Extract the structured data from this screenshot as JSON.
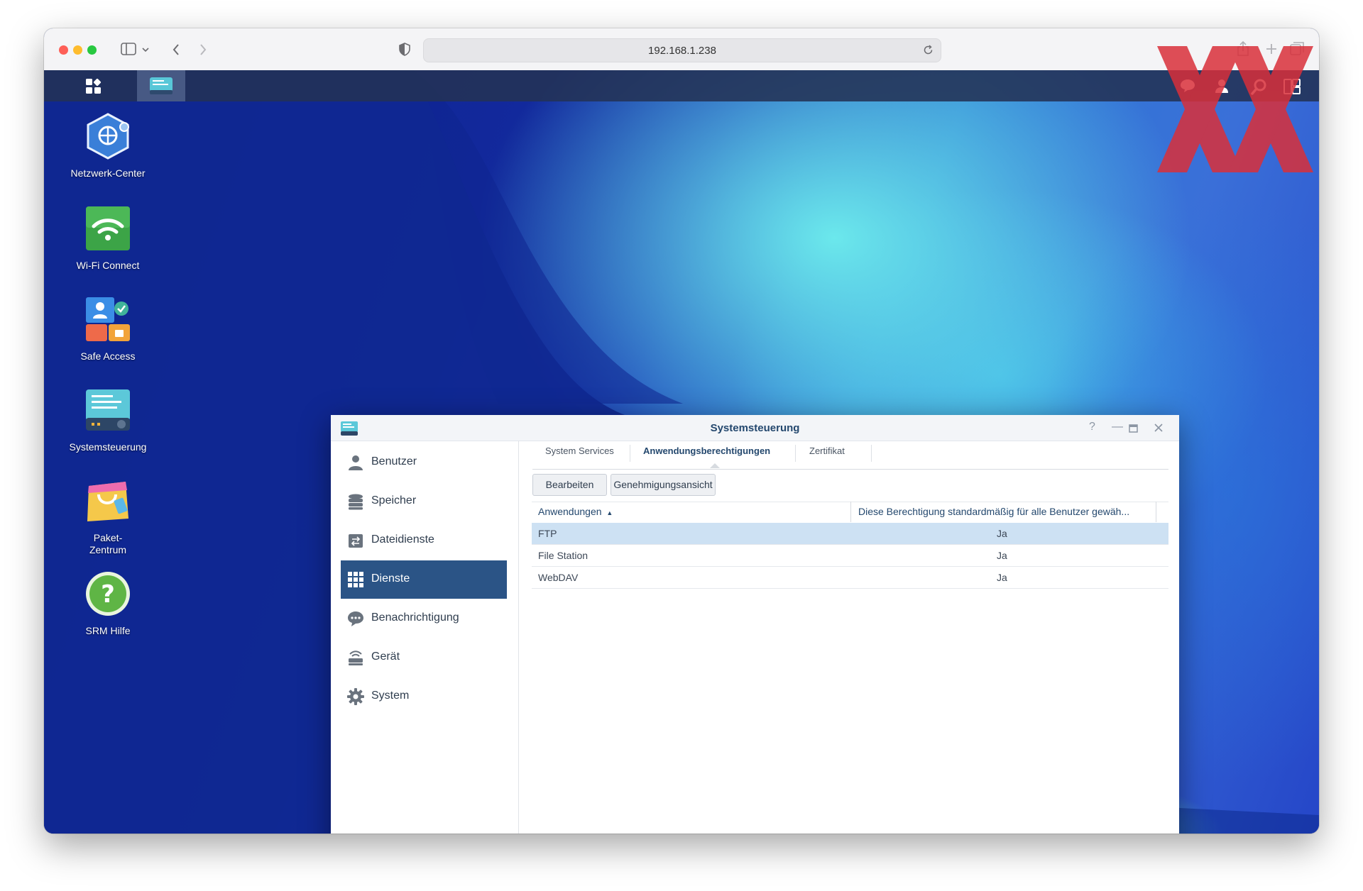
{
  "browser": {
    "address": "192.168.1.238"
  },
  "desktop_icons": [
    {
      "label": "Netzwerk-Center"
    },
    {
      "label": "Wi-Fi Connect"
    },
    {
      "label": "Safe Access"
    },
    {
      "label": "Systemsteuerung"
    },
    {
      "label": "Paket-\nZentrum"
    },
    {
      "label": "SRM Hilfe"
    }
  ],
  "window": {
    "title": "Systemsteuerung",
    "sidebar": [
      {
        "label": "Benutzer",
        "icon": "user-icon"
      },
      {
        "label": "Speicher",
        "icon": "storage-icon"
      },
      {
        "label": "Dateidienste",
        "icon": "file-services-icon"
      },
      {
        "label": "Dienste",
        "icon": "services-grid-icon",
        "active": true
      },
      {
        "label": "Benachrichtigung",
        "icon": "chat-bubble-icon"
      },
      {
        "label": "Gerät",
        "icon": "router-icon"
      },
      {
        "label": "System",
        "icon": "gear-icon"
      }
    ],
    "tabs": [
      {
        "label": "System Services"
      },
      {
        "label": "Anwendungsberechtigungen",
        "active": true
      },
      {
        "label": "Zertifikat"
      }
    ],
    "buttons": {
      "edit": "Bearbeiten",
      "approval_view": "Genehmigungsansicht"
    },
    "table": {
      "columns": [
        "Anwendungen",
        "Diese Berechtigung standardmäßig für alle Benutzer gewäh..."
      ],
      "rows": [
        {
          "app": "FTP",
          "default": "Ja",
          "selected": true
        },
        {
          "app": "File Station",
          "default": "Ja"
        },
        {
          "app": "WebDAV",
          "default": "Ja"
        }
      ]
    }
  },
  "colors": {
    "accent": "#2b5486",
    "selection": "#cde1f3",
    "watermark": "#d9303a"
  }
}
